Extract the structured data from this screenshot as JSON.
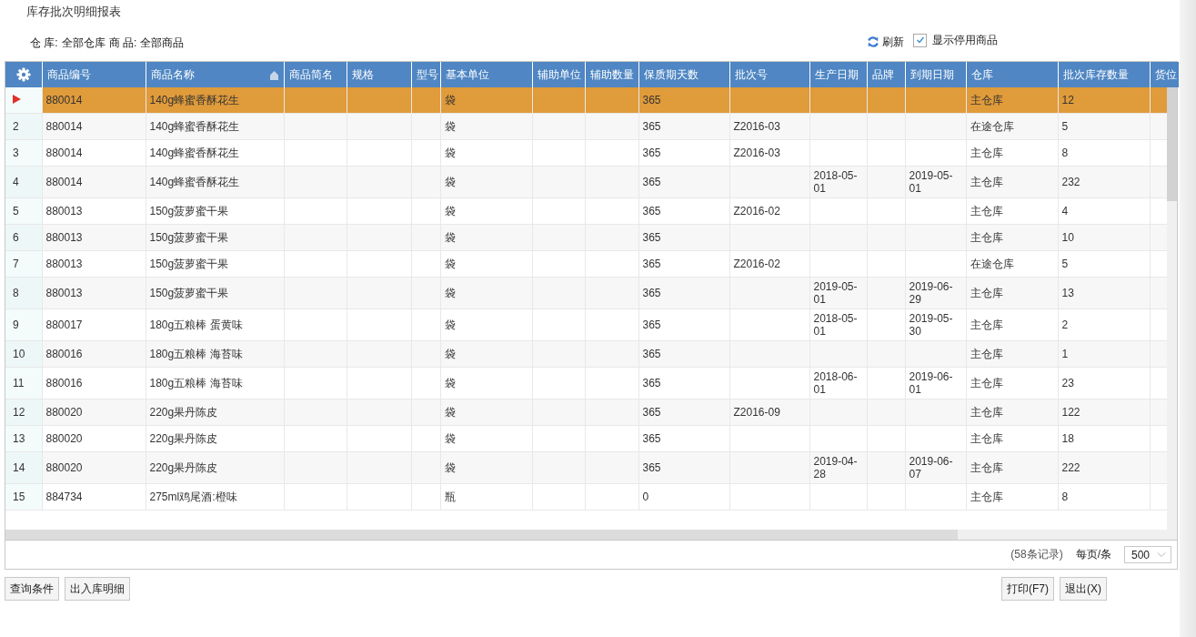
{
  "window": {
    "title": "库存批次明细报表"
  },
  "filters": [
    {
      "label": "仓 库:",
      "value": "全部仓库"
    },
    {
      "label": "商 品:",
      "value": "全部商品"
    }
  ],
  "toolbar": {
    "refresh": "刷新",
    "show_disabled": {
      "label": "显示停用商品",
      "checked": true
    }
  },
  "table": {
    "columns": [
      {
        "label": "商品编号",
        "sorted": false
      },
      {
        "label": "商品名称",
        "sorted": true
      },
      {
        "label": "商品简名",
        "sorted": false
      },
      {
        "label": "规格",
        "sorted": false
      },
      {
        "label": "型号",
        "sorted": false
      },
      {
        "label": "基本单位",
        "sorted": false
      },
      {
        "label": "辅助单位",
        "sorted": false
      },
      {
        "label": "辅助数量",
        "sorted": false
      },
      {
        "label": "保质期天数",
        "sorted": false
      },
      {
        "label": "批次号",
        "sorted": false
      },
      {
        "label": "生产日期",
        "sorted": false
      },
      {
        "label": "品牌",
        "sorted": false
      },
      {
        "label": "到期日期",
        "sorted": false
      },
      {
        "label": "仓库",
        "sorted": false
      },
      {
        "label": "批次库存数量",
        "sorted": false
      },
      {
        "label": "货位",
        "sorted": false
      }
    ],
    "rows": [
      {
        "number": null,
        "selected": true,
        "cells": [
          "880014",
          "140g蜂蜜香酥花生",
          null,
          null,
          null,
          "袋",
          null,
          null,
          "365",
          null,
          null,
          null,
          null,
          "主仓库",
          "12",
          null
        ]
      },
      {
        "number": "2",
        "selected": false,
        "cells": [
          "880014",
          "140g蜂蜜香酥花生",
          null,
          null,
          null,
          "袋",
          null,
          null,
          "365",
          "Z2016-03",
          null,
          null,
          null,
          "在途仓库",
          "5",
          null
        ]
      },
      {
        "number": "3",
        "selected": false,
        "cells": [
          "880014",
          "140g蜂蜜香酥花生",
          null,
          null,
          null,
          "袋",
          null,
          null,
          "365",
          "Z2016-03",
          null,
          null,
          null,
          "主仓库",
          "8",
          null
        ]
      },
      {
        "number": "4",
        "selected": false,
        "cells": [
          "880014",
          "140g蜂蜜香酥花生",
          null,
          null,
          null,
          "袋",
          null,
          null,
          "365",
          null,
          "2018-05-01",
          null,
          "2019-05-01",
          "主仓库",
          "232",
          null
        ]
      },
      {
        "number": "5",
        "selected": false,
        "cells": [
          "880013",
          "150g菠萝蜜干果",
          null,
          null,
          null,
          "袋",
          null,
          null,
          "365",
          "Z2016-02",
          null,
          null,
          null,
          "主仓库",
          "4",
          null
        ]
      },
      {
        "number": "6",
        "selected": false,
        "cells": [
          "880013",
          "150g菠萝蜜干果",
          null,
          null,
          null,
          "袋",
          null,
          null,
          "365",
          null,
          null,
          null,
          null,
          "主仓库",
          "10",
          null
        ]
      },
      {
        "number": "7",
        "selected": false,
        "cells": [
          "880013",
          "150g菠萝蜜干果",
          null,
          null,
          null,
          "袋",
          null,
          null,
          "365",
          "Z2016-02",
          null,
          null,
          null,
          "在途仓库",
          "5",
          null
        ]
      },
      {
        "number": "8",
        "selected": false,
        "cells": [
          "880013",
          "150g菠萝蜜干果",
          null,
          null,
          null,
          "袋",
          null,
          null,
          "365",
          null,
          "2019-05-01",
          null,
          "2019-06-29",
          "主仓库",
          "13",
          null
        ]
      },
      {
        "number": "9",
        "selected": false,
        "cells": [
          "880017",
          "180g五粮棒 蛋黄味",
          null,
          null,
          null,
          "袋",
          null,
          null,
          "365",
          null,
          "2018-05-01",
          null,
          "2019-05-30",
          "主仓库",
          "2",
          null
        ]
      },
      {
        "number": "10",
        "selected": false,
        "cells": [
          "880016",
          "180g五粮棒 海苔味",
          null,
          null,
          null,
          "袋",
          null,
          null,
          "365",
          null,
          null,
          null,
          null,
          "主仓库",
          "1",
          null
        ]
      },
      {
        "number": "11",
        "selected": false,
        "cells": [
          "880016",
          "180g五粮棒 海苔味",
          null,
          null,
          null,
          "袋",
          null,
          null,
          "365",
          null,
          "2018-06-01",
          null,
          "2019-06-01",
          "主仓库",
          "23",
          null
        ]
      },
      {
        "number": "12",
        "selected": false,
        "cells": [
          "880020",
          "220g果丹陈皮",
          null,
          null,
          null,
          "袋",
          null,
          null,
          "365",
          "Z2016-09",
          null,
          null,
          null,
          "主仓库",
          "122",
          null
        ]
      },
      {
        "number": "13",
        "selected": false,
        "cells": [
          "880020",
          "220g果丹陈皮",
          null,
          null,
          null,
          "袋",
          null,
          null,
          "365",
          null,
          null,
          null,
          null,
          "主仓库",
          "18",
          null
        ]
      },
      {
        "number": "14",
        "selected": false,
        "cells": [
          "880020",
          "220g果丹陈皮",
          null,
          null,
          null,
          "袋",
          null,
          null,
          "365",
          null,
          "2019-04-28",
          null,
          "2019-06-07",
          "主仓库",
          "222",
          null
        ]
      },
      {
        "number": "15",
        "selected": false,
        "cells": [
          "884734",
          "275ml鸡尾酒:橙味",
          null,
          null,
          null,
          "瓶",
          null,
          null,
          "0",
          null,
          null,
          null,
          null,
          "主仓库",
          "8",
          null
        ]
      }
    ]
  },
  "pager": {
    "record_count": "(58条记录)",
    "page_size_label": "每页/条",
    "page_size": "500"
  },
  "buttons_left": [
    "查询条件",
    "出入库明细"
  ],
  "buttons_right": [
    "打印(F7)",
    "退出(X)"
  ]
}
